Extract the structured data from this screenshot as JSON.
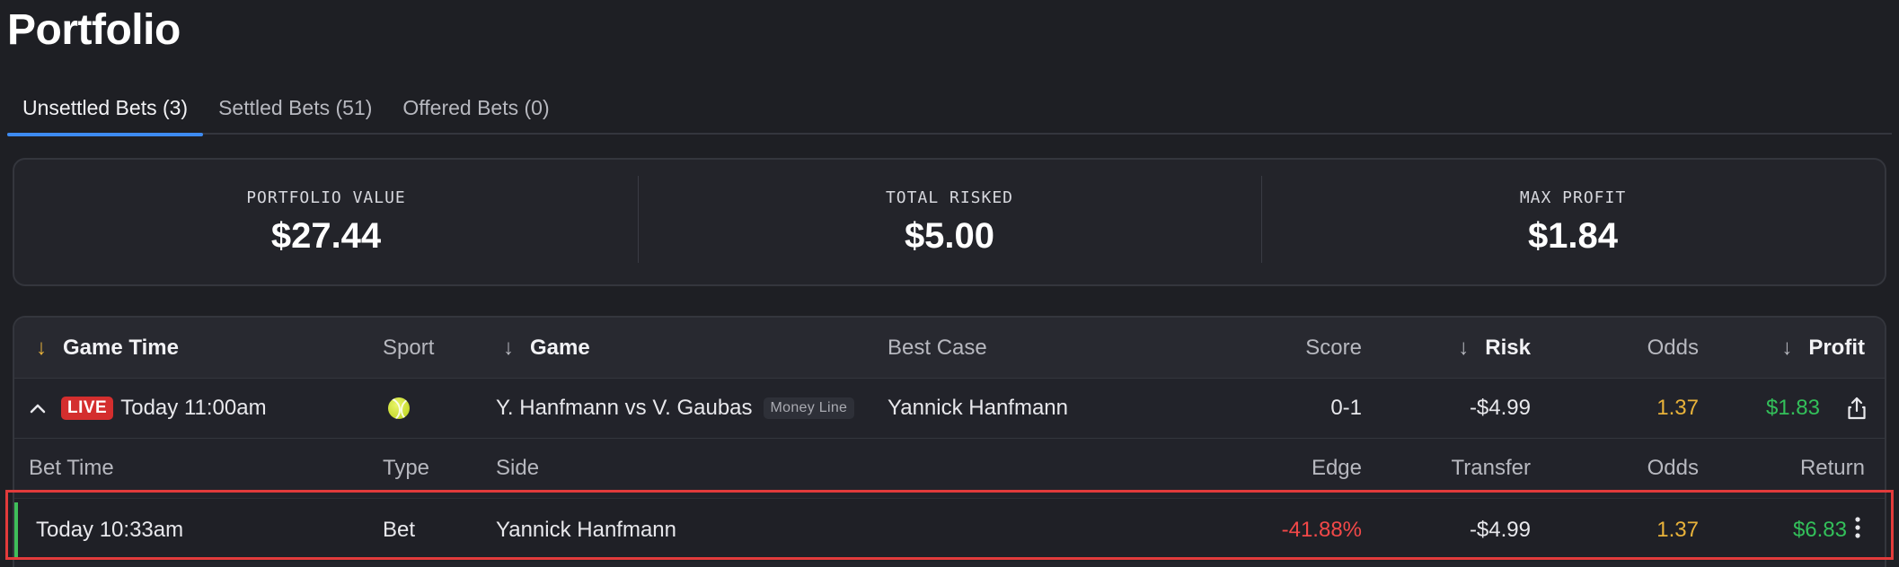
{
  "page": {
    "title": "Portfolio"
  },
  "tabs": [
    {
      "label": "Unsettled Bets (3)",
      "active": true
    },
    {
      "label": "Settled Bets (51)",
      "active": false
    },
    {
      "label": "Offered Bets (0)",
      "active": false
    }
  ],
  "summary": {
    "portfolio_value_label": "PORTFOLIO VALUE",
    "portfolio_value": "$27.44",
    "total_risked_label": "TOTAL RISKED",
    "total_risked": "$5.00",
    "max_profit_label": "MAX PROFIT",
    "max_profit": "$1.84"
  },
  "table": {
    "headers": {
      "game_time": "Game Time",
      "sport": "Sport",
      "game": "Game",
      "best_case": "Best Case",
      "score": "Score",
      "risk": "Risk",
      "odds": "Odds",
      "profit": "Profit"
    },
    "game_row": {
      "live_label": "LIVE",
      "time": "Today 11:00am",
      "sport_icon": "tennis-ball-icon",
      "game": "Y. Hanfmann vs V. Gaubas",
      "market": "Money Line",
      "best_case": "Yannick Hanfmann",
      "score": "0-1",
      "risk": "-$4.99",
      "odds": "1.37",
      "profit": "$1.83"
    },
    "bet_headers": {
      "bet_time": "Bet Time",
      "type": "Type",
      "side": "Side",
      "edge": "Edge",
      "transfer": "Transfer",
      "odds": "Odds",
      "return": "Return"
    },
    "bet_row": {
      "bet_time": "Today 10:33am",
      "type": "Bet",
      "side": "Yannick Hanfmann",
      "edge": "-41.88%",
      "transfer": "-$4.99",
      "odds": "1.37",
      "return": "$6.83"
    }
  },
  "colors": {
    "accent_blue": "#3d8bf2",
    "live_red": "#d42e2e",
    "odds_gold": "#e8b23a",
    "profit_green": "#33c05a",
    "edge_red": "#f24848",
    "highlight_red": "#e23b3b"
  }
}
